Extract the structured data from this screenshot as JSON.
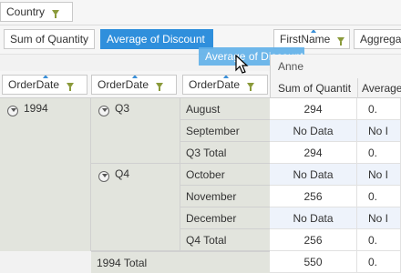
{
  "filter_area": {
    "chips": [
      {
        "label": "Country"
      }
    ]
  },
  "data_area": {
    "chips": [
      {
        "label": "Sum of Quantity"
      },
      {
        "label": "Average of Discount"
      }
    ],
    "column_chips": [
      {
        "label": "FirstName"
      },
      {
        "label": "Aggrega"
      }
    ]
  },
  "drag_ghost": {
    "label": "Average of Discount"
  },
  "row_fields": [
    {
      "label": "OrderDate"
    },
    {
      "label": "OrderDate"
    },
    {
      "label": "OrderDate"
    }
  ],
  "column_header": {
    "member": "Anne",
    "measures": [
      "Sum of Quantit",
      "Average"
    ]
  },
  "rows": {
    "year": "1994",
    "quarters": [
      {
        "label": "Q3",
        "total_label": "Q3 Total"
      },
      {
        "label": "Q4",
        "total_label": "Q4 Total"
      }
    ],
    "months": [
      {
        "label": "August",
        "qty": "294",
        "disc": "0."
      },
      {
        "label": "September",
        "qty": "No Data",
        "disc": "No I"
      },
      {
        "label": "Q3 Total",
        "qty": "294",
        "disc": "0."
      },
      {
        "label": "October",
        "qty": "No Data",
        "disc": "No I"
      },
      {
        "label": "November",
        "qty": "256",
        "disc": "0."
      },
      {
        "label": "December",
        "qty": "No Data",
        "disc": "No I"
      },
      {
        "label": "Q4 Total",
        "qty": "256",
        "disc": "0."
      }
    ],
    "year_total": {
      "label": "1994 Total",
      "qty": "550",
      "disc": "0."
    }
  }
}
